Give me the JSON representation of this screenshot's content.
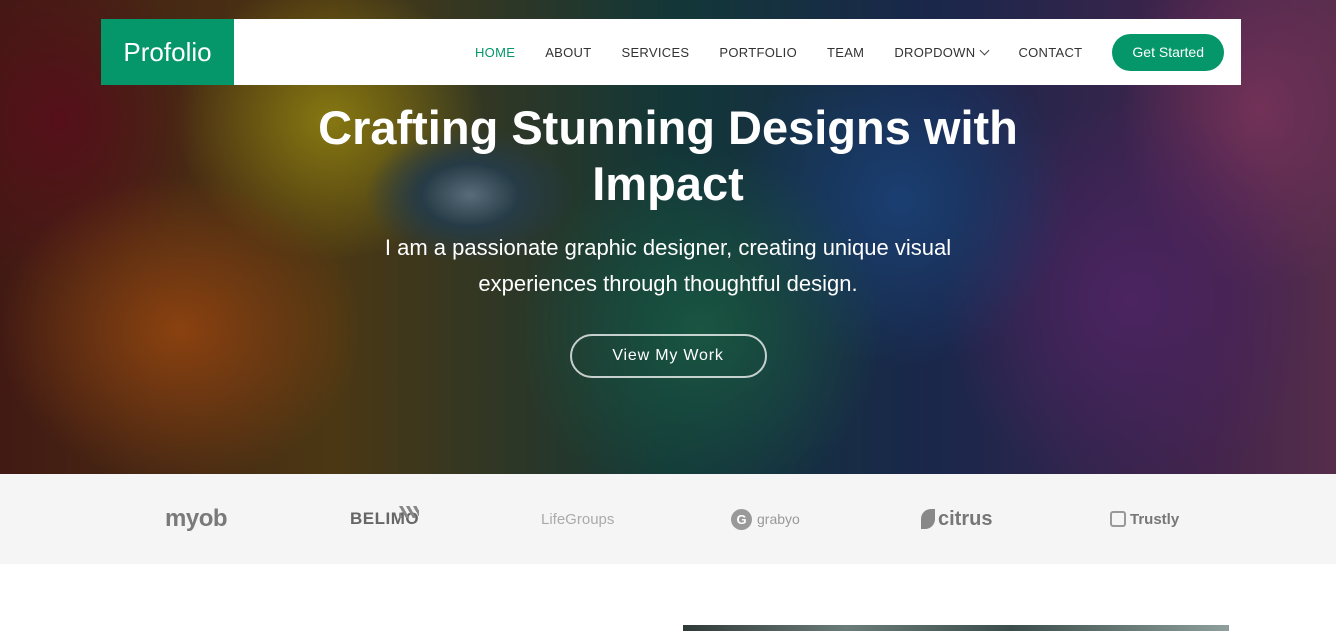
{
  "brand": {
    "name": "Profolio",
    "accent": "#059669"
  },
  "nav": {
    "items": [
      {
        "label": "HOME",
        "active": true
      },
      {
        "label": "ABOUT"
      },
      {
        "label": "SERVICES"
      },
      {
        "label": "PORTFOLIO"
      },
      {
        "label": "TEAM"
      },
      {
        "label": "DROPDOWN",
        "icon": "chevron-down-icon"
      },
      {
        "label": "CONTACT"
      }
    ],
    "cta_label": "Get Started"
  },
  "hero": {
    "headline": "Crafting Stunning Designs with Impact",
    "subtitle": "I am a passionate graphic designer, creating unique visual experiences through thoughtful design.",
    "button_label": "View My Work"
  },
  "clients": [
    "myob",
    "BELIMO",
    "LifeGroups",
    "grabyo",
    "citrus",
    "Trustly"
  ]
}
